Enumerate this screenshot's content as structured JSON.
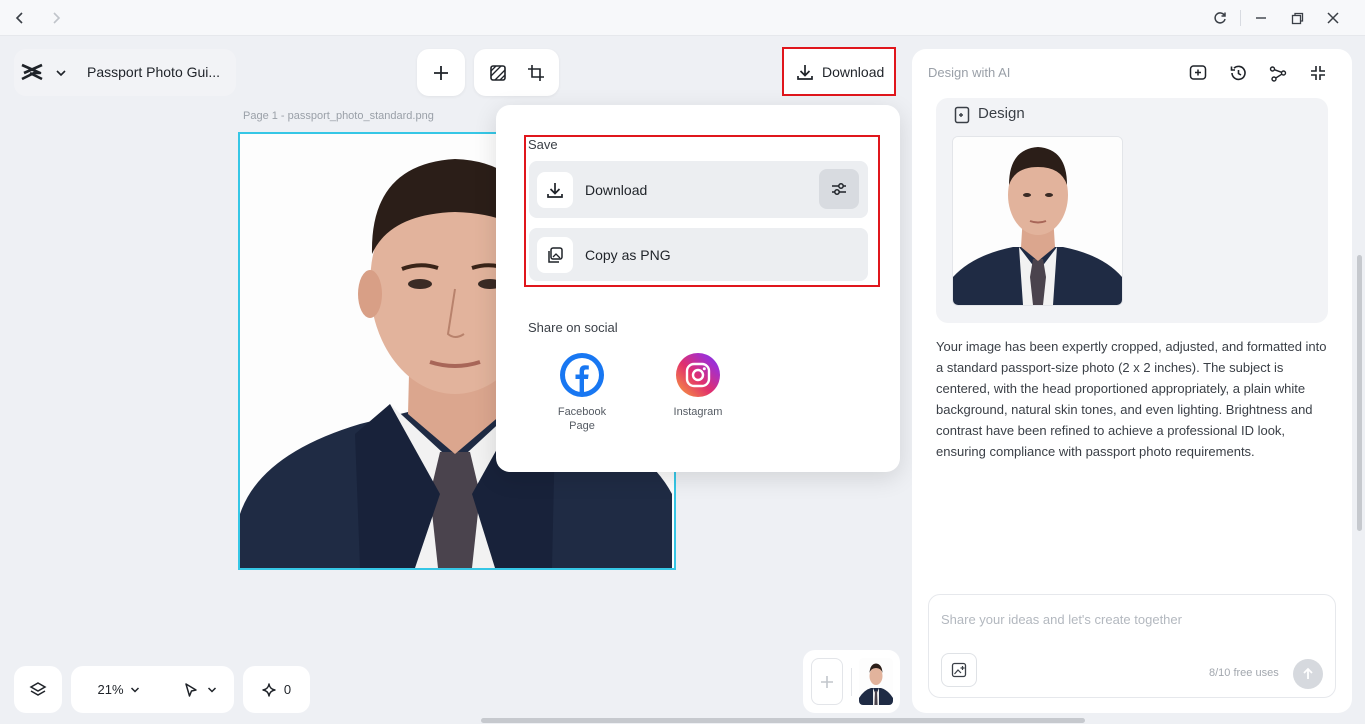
{
  "app": {
    "project_title": "Passport Photo Gui...",
    "page_label": "Page 1 -   passport_photo_standard.png"
  },
  "toolbar": {
    "download_label": "Download"
  },
  "popover": {
    "save_label": "Save",
    "download_label": "Download",
    "copy_label": "Copy as PNG",
    "share_label": "Share on social",
    "facebook_label_line1": "Facebook",
    "facebook_label_line2": "Page",
    "instagram_label": "Instagram"
  },
  "panel": {
    "title": "Design with AI",
    "design_title": "Design",
    "description": "Your image has been expertly cropped, adjusted, and formatted into a standard passport-size photo (2 x 2 inches). The subject is centered, with the head proportioned appropriately, a plain white background, natural skin tones, and even lighting. Brightness and contrast have been refined to achieve a professional ID look, ensuring compliance with passport photo requirements.",
    "input_placeholder": "Share your ideas and let's create together",
    "free_uses": "8/10 free uses"
  },
  "bottom": {
    "zoom": "21%",
    "ai_count": "0"
  },
  "colors": {
    "highlight": "#e0161c",
    "selection": "#36c7e6",
    "facebook": "#1877f2"
  }
}
